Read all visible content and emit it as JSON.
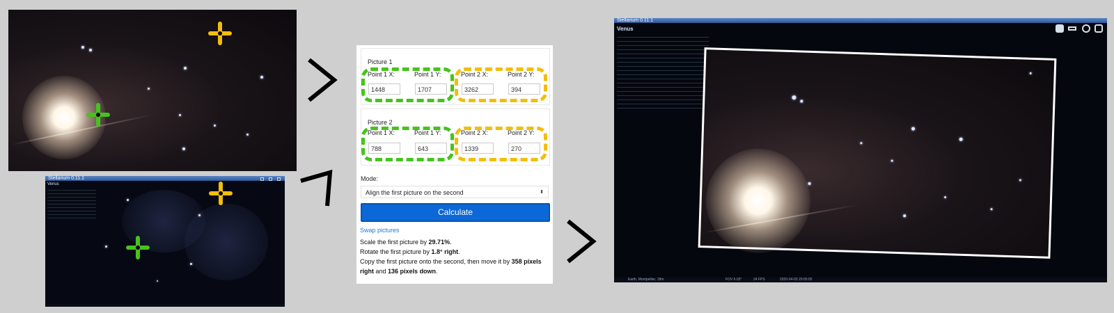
{
  "top_photo": {},
  "stellarium_small": {
    "title": "Stellarium 0.11.1",
    "object": "Venus"
  },
  "form": {
    "picture1": {
      "title": "Picture 1",
      "p1x_label": "Point 1 X:",
      "p1y_label": "Point 1 Y:",
      "p2x_label": "Point 2 X:",
      "p2y_label": "Point 2 Y:",
      "p1x": "1448",
      "p1y": "1707",
      "p2x": "3262",
      "p2y": "394"
    },
    "picture2": {
      "title": "Picture 2",
      "p1x_label": "Point 1 X:",
      "p1y_label": "Point 1 Y:",
      "p2x_label": "Point 2 X:",
      "p2y_label": "Point 2 Y:",
      "p1x": "788",
      "p1y": "643",
      "p2x": "1339",
      "p2y": "270"
    },
    "mode_label": "Mode:",
    "mode_value": "Align the first picture on the second",
    "calculate_label": "Calculate",
    "swap_label": "Swap pictures",
    "result": {
      "scale_prefix": "Scale the first picture by ",
      "scale_value": "29.71%",
      "scale_suffix": ".",
      "rotate_prefix": "Rotate the first picture by ",
      "rotate_value": "1.8° right",
      "rotate_suffix": ".",
      "copy_prefix": "Copy the first picture onto the second, then move it by ",
      "copy_right": "358 pixels right",
      "copy_and": " and ",
      "copy_down": "136 pixels down",
      "copy_suffix": "."
    }
  },
  "stellarium_large": {
    "title": "Stellarium 0.11.1",
    "object": "Venus",
    "status_location": "Earth, Montpellier, 18m",
    "status_fov": "FOV 6.03°",
    "status_fps": "24 FPS",
    "status_datetime": "2020-04-03  20:05:05"
  },
  "colors": {
    "green_marker": "#46c31c",
    "yellow_marker": "#f3bd0c",
    "button_blue": "#0b68d6",
    "link_blue": "#1e7bd4"
  },
  "icons": [
    "crosshair-marker-icon",
    "right-arrow-icon",
    "select-arrows-icon"
  ]
}
